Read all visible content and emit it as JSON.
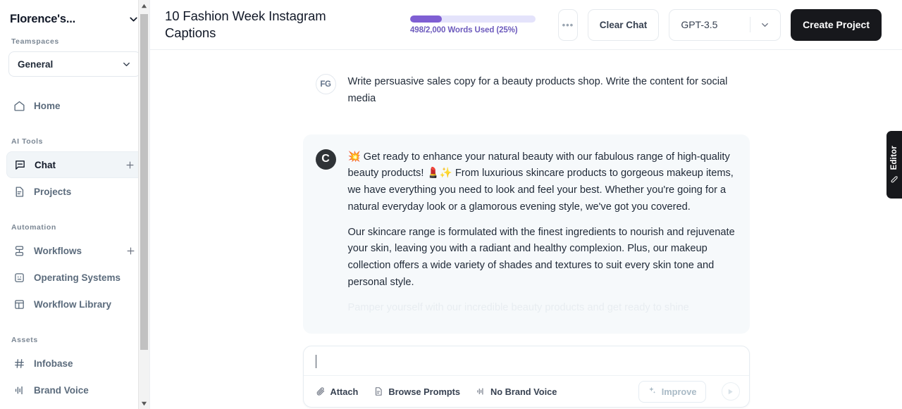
{
  "sidebar": {
    "workspace": {
      "name": "Florence's...",
      "chevron_icon": "chevron-down-icon"
    },
    "teamspaces_label": "Teamspaces",
    "teamspace_selected": "General",
    "ai_tools_label": "AI Tools",
    "automation_label": "Automation",
    "assets_label": "Assets",
    "items": [
      {
        "label": "Home",
        "icon": "home-icon",
        "active": false,
        "plus": false
      },
      {
        "label": "Chat",
        "icon": "chat-bubble-icon",
        "active": true,
        "plus": true
      },
      {
        "label": "Projects",
        "icon": "document-icon",
        "active": false,
        "plus": false
      },
      {
        "label": "Workflows",
        "icon": "workflow-icon",
        "active": false,
        "plus": true
      },
      {
        "label": "Operating Systems",
        "icon": "operating-system-icon",
        "active": false,
        "plus": false
      },
      {
        "label": "Workflow Library",
        "icon": "library-layout-icon",
        "active": false,
        "plus": false
      },
      {
        "label": "Infobase",
        "icon": "hash-icon",
        "active": false,
        "plus": false
      },
      {
        "label": "Brand Voice",
        "icon": "waveform-icon",
        "active": false,
        "plus": false
      }
    ]
  },
  "header": {
    "title": "10 Fashion Week Instagram Captions",
    "words": {
      "used": 498,
      "total": "2,000",
      "percent": 25,
      "text": "498/2,000 Words Used (25%)",
      "fill_color": "#7f5fd3",
      "track_color": "#e4e3fb",
      "text_color": "#6d5bbd"
    },
    "more_label": "•••",
    "clear_chat_label": "Clear Chat",
    "model_selected": "GPT-3.5",
    "model_chevron_icon": "chevron-down-icon",
    "create_project_label": "Create Project",
    "create_project_color": "#17181c"
  },
  "chat": {
    "user_message": {
      "avatar_initials": "FG",
      "text": "Write persuasive sales copy for a beauty products shop. Write the content for social media"
    },
    "assistant_message": {
      "avatar_letter": "C",
      "paragraphs": [
        "💥 Get ready to enhance your natural beauty with our fabulous range of high-quality beauty products! 💄✨ From luxurious skincare products to gorgeous makeup items, we have everything you need to look and feel your best. Whether you're going for a natural everyday look or a glamorous evening style, we've got you covered.",
        "Our skincare range is formulated with the finest ingredients to nourish and rejuvenate your skin, leaving you with a radiant and healthy complexion. Plus, our makeup collection offers a wide variety of shades and textures to suit every skin tone and personal style.",
        "Pamper yourself with our incredible beauty products and get ready to shine"
      ]
    }
  },
  "composer": {
    "input_value": "",
    "input_placeholder": "",
    "attach_label": "Attach",
    "browse_prompts_label": "Browse Prompts",
    "brand_voice_label": "No Brand Voice",
    "improve_label": "Improve",
    "send_icon": "send-arrow-icon"
  },
  "editor_tab": {
    "label": "Editor",
    "icon": "pencil-icon"
  }
}
